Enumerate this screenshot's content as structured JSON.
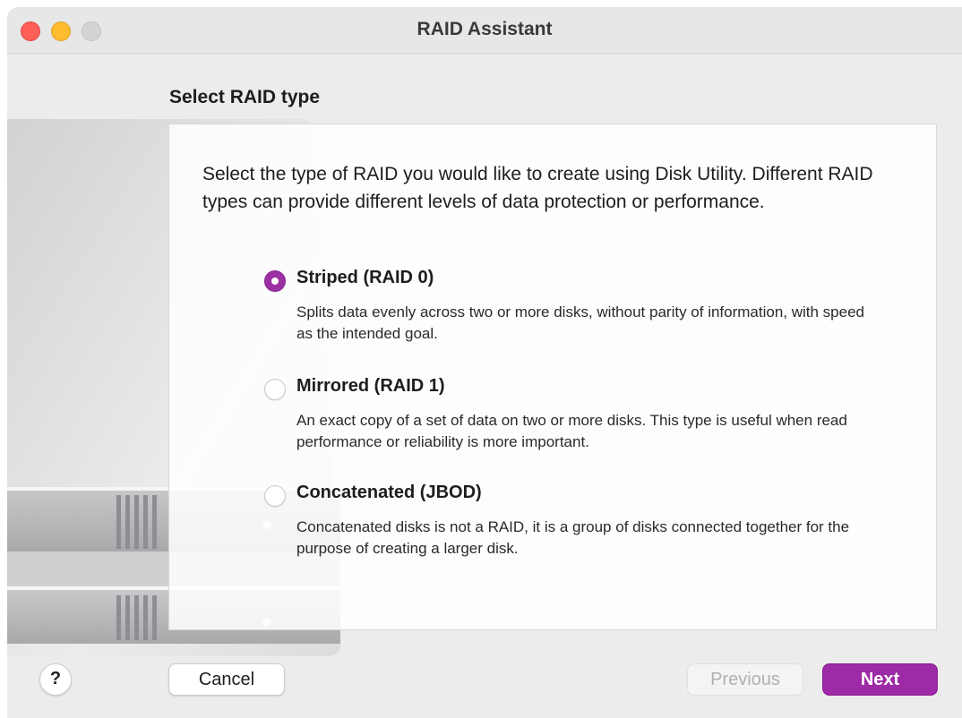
{
  "window": {
    "title": "RAID Assistant"
  },
  "section": {
    "heading": "Select RAID type",
    "intro": "Select the type of RAID you would like to create using Disk Utility. Different RAID types can provide different levels of data protection or performance."
  },
  "options": [
    {
      "title": "Striped (RAID 0)",
      "description": "Splits data evenly across two or more disks, without parity of information, with speed as the intended goal.",
      "selected": true
    },
    {
      "title": "Mirrored (RAID 1)",
      "description": "An exact copy of a set of data on two or more disks. This type is useful when read performance or reliability is more important.",
      "selected": false
    },
    {
      "title": "Concatenated (JBOD)",
      "description": "Concatenated disks is not a RAID, it is a group of disks connected together for the purpose of creating a larger disk.",
      "selected": false
    }
  ],
  "footer": {
    "help_label": "?",
    "cancel_label": "Cancel",
    "previous_label": "Previous",
    "next_label": "Next"
  },
  "colors": {
    "accent": "#9d2aa6",
    "close": "#fe5f57",
    "minimize": "#febc2e",
    "zoom_inactive": "#d3d3d3"
  },
  "icons": {
    "close": "close-icon",
    "minimize": "minimize-icon",
    "zoom": "zoom-icon",
    "artwork": "disk-drive-icon"
  }
}
